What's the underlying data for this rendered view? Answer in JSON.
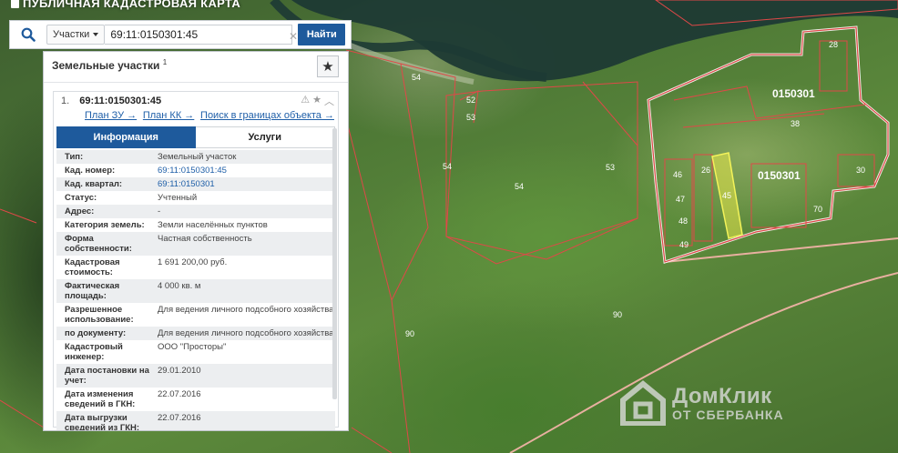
{
  "app": {
    "title": "ПУБЛИЧНАЯ КАДАСТРОВАЯ КАРТА"
  },
  "search": {
    "type_label": "Участки",
    "value": "69:11:0150301:45",
    "button_label": "Найти"
  },
  "panel": {
    "title": "Земельные участки",
    "count": "1"
  },
  "result": {
    "index": "1.",
    "id": "69:11:0150301:45",
    "links": {
      "plan_zu": "План ЗУ →",
      "plan_kk": "План КК →",
      "search_bounds": "Поиск в границах объекта →"
    },
    "tabs": {
      "info": "Информация",
      "services": "Услуги"
    },
    "attributes": [
      {
        "key": "Тип:",
        "value": "Земельный участок"
      },
      {
        "key": "Кад. номер:",
        "value": "69:11:0150301:45"
      },
      {
        "key": "Кад. квартал:",
        "value": "69:11:0150301"
      },
      {
        "key": "Статус:",
        "value": "Учтенный"
      },
      {
        "key": "Адрес:",
        "value": "-"
      },
      {
        "key": "Категория земель:",
        "value": "Земли населённых пунктов"
      },
      {
        "key": "Форма собственности:",
        "value": "Частная собственность"
      },
      {
        "key": "Кадастровая стоимость:",
        "value": "1 691 200,00 руб."
      },
      {
        "key": "Фактическая площадь:",
        "value": "4 000 кв. м"
      },
      {
        "key": "Разрешенное использование:",
        "value": "Для ведения личного подсобного хозяйства"
      },
      {
        "key": "по документу:",
        "value": "Для ведения личного подсобного хозяйства"
      },
      {
        "key": "Кадастровый инженер:",
        "value": "ООО \"Просторы\""
      },
      {
        "key": "Дата постановки на учет:",
        "value": "29.01.2010"
      },
      {
        "key": "Дата изменения сведений в ГКН:",
        "value": "22.07.2016"
      },
      {
        "key": "Дата выгрузки сведений из ГКН:",
        "value": "22.07.2016"
      }
    ]
  },
  "map": {
    "quarter_labels": [
      "0150301",
      "0150301"
    ],
    "plot_labels": [
      "54",
      "52",
      "53",
      "54",
      "54",
      "53",
      "90",
      "90",
      "28",
      "70",
      "46",
      "47",
      "48",
      "49",
      "45",
      "38",
      "26",
      "30"
    ]
  },
  "watermark": {
    "brand": "ДомКлик",
    "sub": "ОТ СБЕРБАНКА"
  },
  "colors": {
    "boundary": "#e04848",
    "quarter_boundary": "#ff6b6b",
    "highlight": "#e8e84a",
    "accent": "#1e5a9c"
  }
}
